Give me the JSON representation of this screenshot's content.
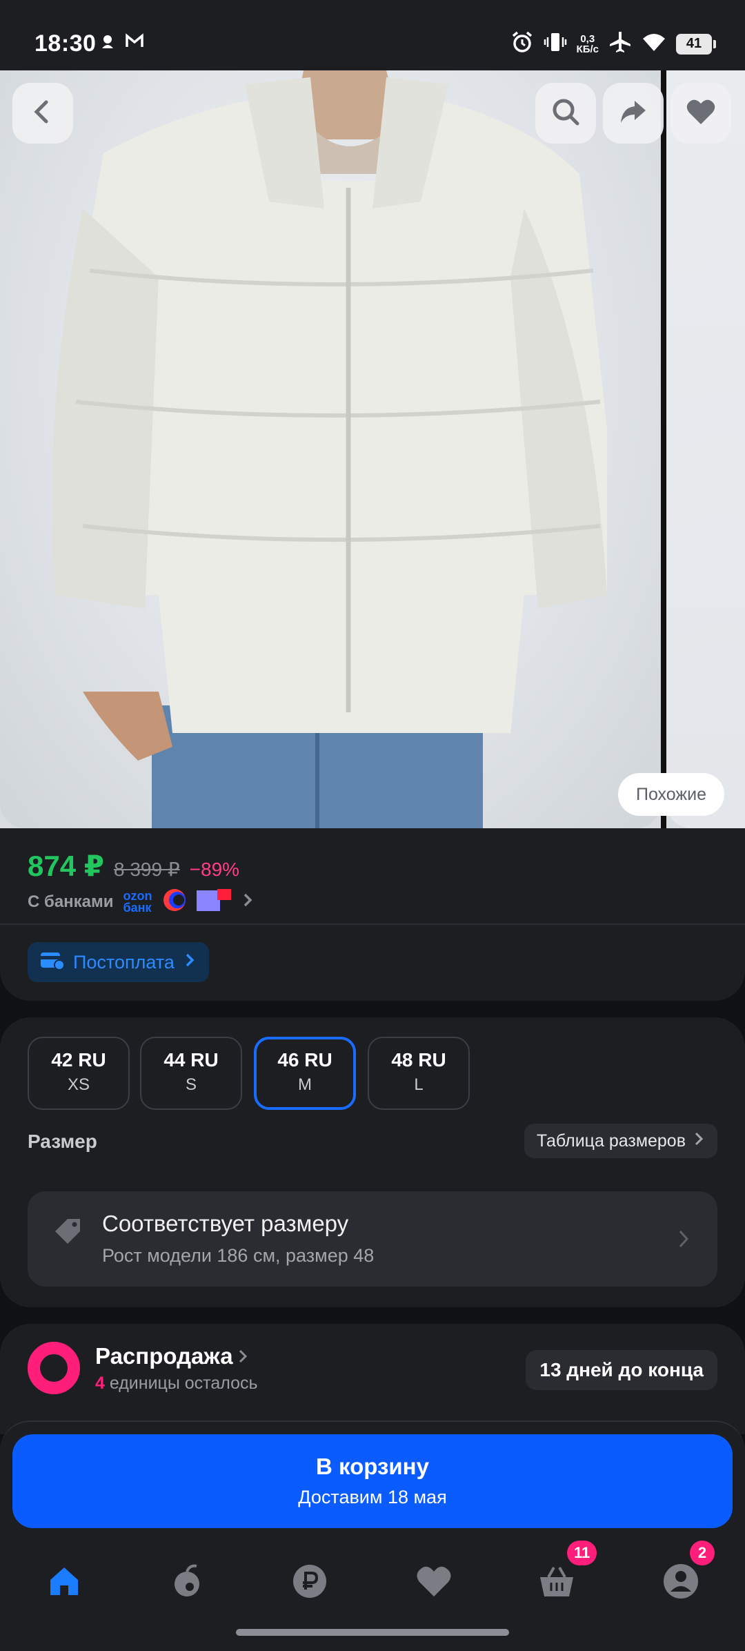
{
  "status_bar": {
    "time": "18:30",
    "speed_value": "0,3",
    "speed_unit": "КБ/с",
    "battery": "41",
    "icons": [
      "notification-icon",
      "mail-icon",
      "alarm-icon",
      "vibrate-icon",
      "airplane-icon",
      "wifi-icon",
      "battery-icon"
    ]
  },
  "gallery": {
    "similar_label": "Похожие",
    "icons": [
      "back-icon",
      "search-icon",
      "share-icon",
      "favorite-icon"
    ]
  },
  "price": {
    "current": "874 ₽",
    "old": "8 399 ₽",
    "discount": "−89%",
    "banks_label": "С банками",
    "ozon_bank_top": "ozon",
    "ozon_bank_bottom": "банк"
  },
  "postpay": {
    "label": "Постоплата"
  },
  "sizes": {
    "options": [
      {
        "ru": "42 RU",
        "letter": "XS",
        "selected": false
      },
      {
        "ru": "44 RU",
        "letter": "S",
        "selected": false
      },
      {
        "ru": "46 RU",
        "letter": "M",
        "selected": true
      },
      {
        "ru": "48 RU",
        "letter": "L",
        "selected": false
      }
    ],
    "label": "Размер",
    "table_button": "Таблица размеров"
  },
  "fit": {
    "title": "Соответствует размеру",
    "subtitle": "Рост модели 186 см, размер 48"
  },
  "sale": {
    "title": "Распродажа",
    "count": "4",
    "remaining_text": "единицы осталось",
    "days_left": "13 дней до конца"
  },
  "cart": {
    "label": "В корзину",
    "delivery": "Доставим 18 мая"
  },
  "nav": {
    "cart_badge": "11",
    "profile_badge": "2",
    "accent": "#0b5cff"
  }
}
